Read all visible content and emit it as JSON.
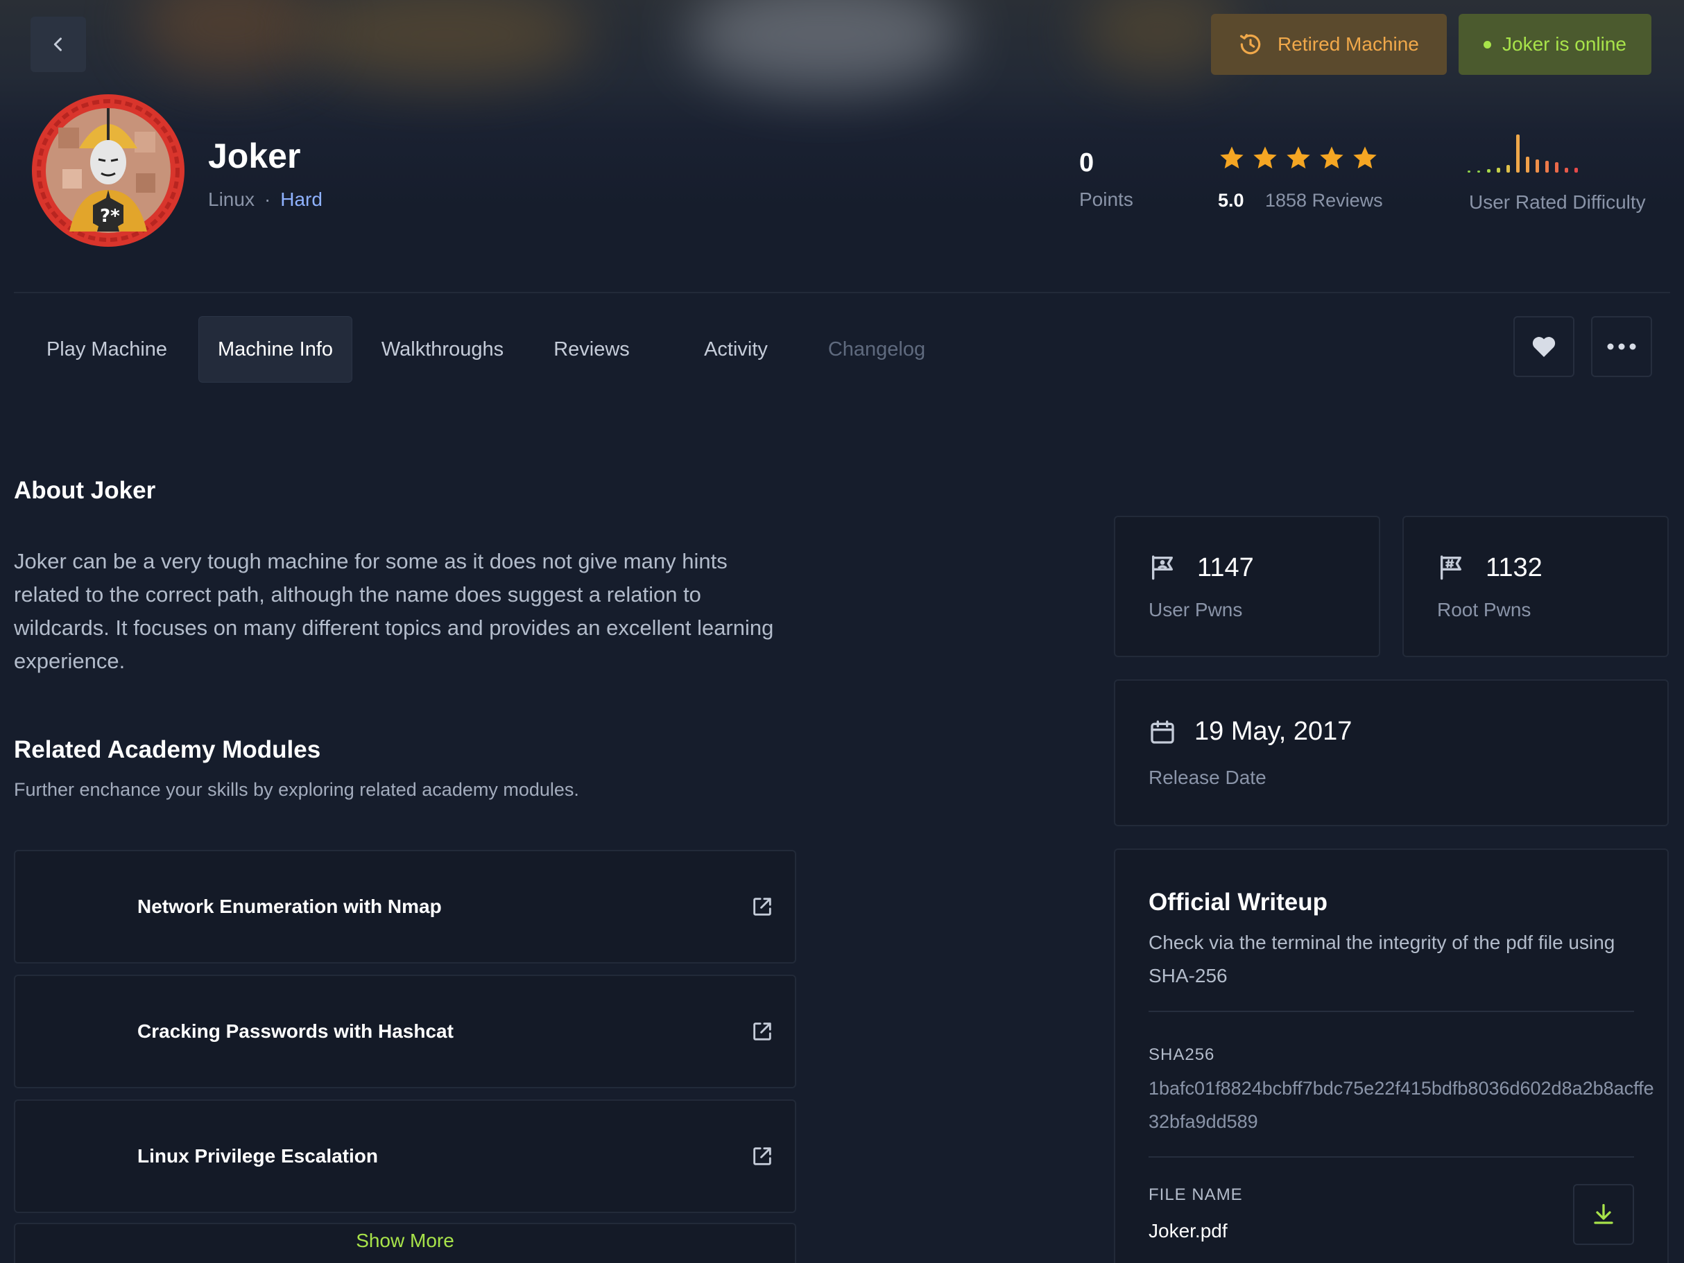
{
  "header": {
    "back_icon": "chevron-left-icon",
    "retired_label": "Retired Machine",
    "online_label": "Joker is online",
    "machine": {
      "name": "Joker",
      "os": "Linux",
      "separator": "·",
      "difficulty": "Hard"
    },
    "stats": {
      "points_value": "0",
      "points_label": "Points",
      "rating_value": "5.0",
      "star_count": 5,
      "reviews_label": "1858 Reviews",
      "difficulty_label": "User Rated Difficulty"
    }
  },
  "tabs": [
    {
      "label": "Play Machine"
    },
    {
      "label": "Machine Info"
    },
    {
      "label": "Walkthroughs"
    },
    {
      "label": "Reviews"
    },
    {
      "label": "Activity"
    },
    {
      "label": "Changelog"
    }
  ],
  "active_tab": "Machine Info",
  "about": {
    "title": "About Joker",
    "text": "Joker can be a very tough machine for some as it does not give many hints related to the correct path, although the name does suggest a relation to wildcards. It focuses on many different topics and provides an excellent learning experience."
  },
  "related": {
    "title": "Related Academy Modules",
    "subtitle": "Further enchance your skills by exploring related academy modules.",
    "modules": [
      {
        "name": "Network Enumeration with Nmap"
      },
      {
        "name": "Cracking Passwords with Hashcat"
      },
      {
        "name": "Linux Privilege Escalation"
      }
    ],
    "show_more": "Show More"
  },
  "pwns": {
    "user_value": "1147",
    "user_label": "User Pwns",
    "root_value": "1132",
    "root_label": "Root Pwns"
  },
  "release": {
    "date": "19 May, 2017",
    "label": "Release Date"
  },
  "writeup": {
    "title": "Official Writeup",
    "description": "Check via the terminal the integrity of the pdf file using SHA-256",
    "sha_label": "SHA256",
    "sha_value": "1bafc01f8824bcbff7bdc75e22f415bdfb8036d602d8a2b8acffe32bfa9dd589",
    "file_label": "FILE NAME",
    "file_name": "Joker.pdf"
  },
  "colors": {
    "background": "#161d2c",
    "accent_green": "#a8e34a",
    "accent_orange": "#f0a84a",
    "star": "#f5a623",
    "hard_blue": "#8fb2ff"
  }
}
